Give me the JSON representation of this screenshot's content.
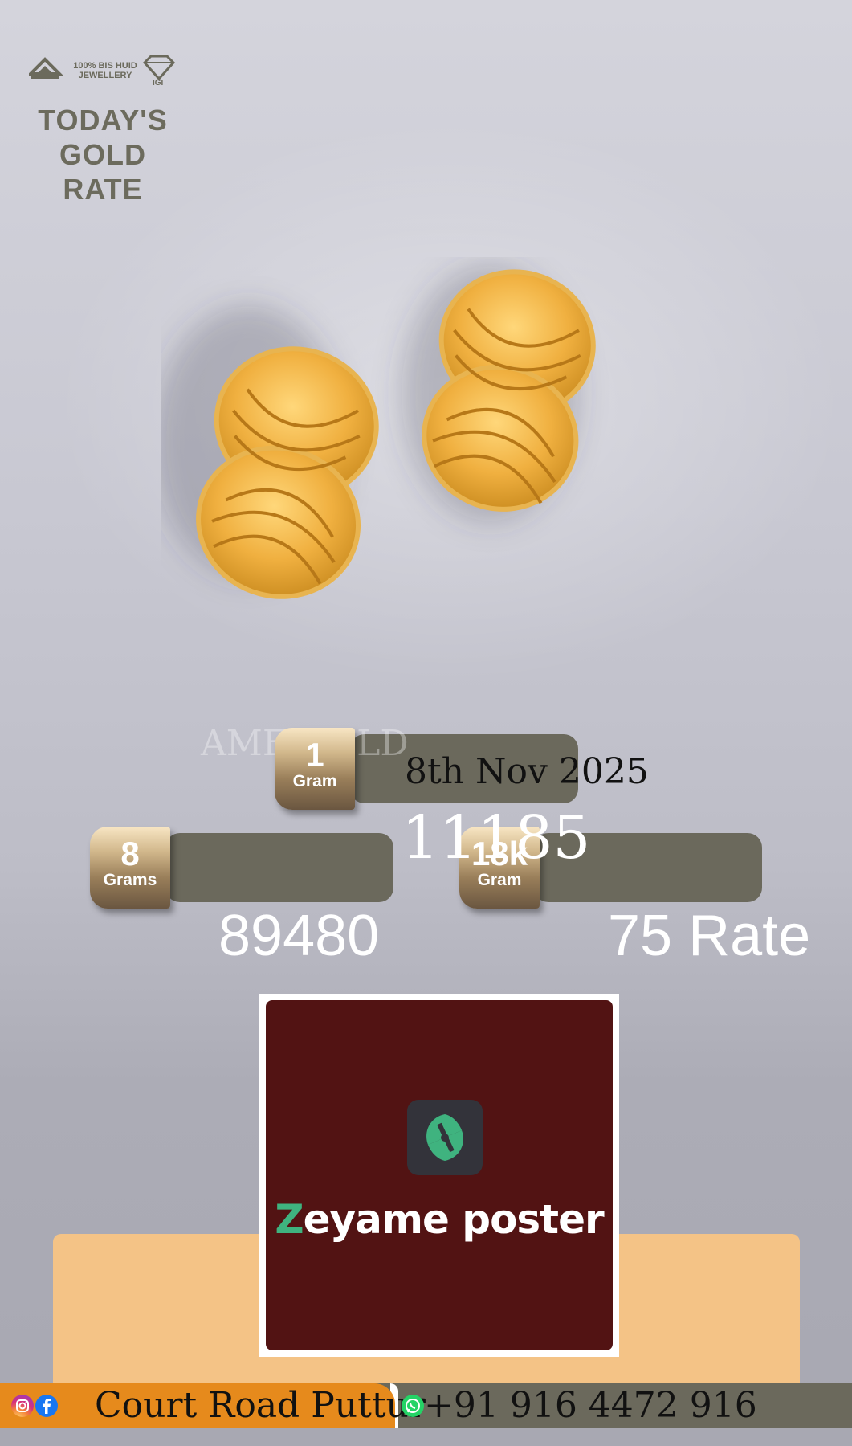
{
  "branding": {
    "bis_text": "100% BIS HUID JEWELLERY",
    "title_lines": [
      "TODAY'S",
      "GOLD",
      "RATE"
    ]
  },
  "shop_name_ghost": "AME GOLD",
  "date": "8th Nov 2025",
  "rates": {
    "one_gram": {
      "qty": "1",
      "unit": "Gram",
      "value": "11185"
    },
    "eight_grams": {
      "qty": "8",
      "unit": "Grams",
      "value": "89480"
    },
    "eighteen_k": {
      "qty": "18k",
      "unit": "Gram",
      "value": "75 Rate"
    }
  },
  "logo": {
    "brand_first": "Z",
    "brand_rest": "eyame poster"
  },
  "footer": {
    "address": "Court Road Puttur",
    "phone": "+91 916 4472 916"
  },
  "colors": {
    "pill": "#6b695c",
    "footer_orange": "#e68a1c",
    "peach": "#f4c386",
    "logo_bg": "#521313",
    "logo_green": "#3fb37f",
    "title": "#6c6b5d"
  },
  "icons": [
    "bis-hallmark-icon",
    "diamond-icon",
    "instagram-icon",
    "facebook-icon",
    "whatsapp-icon"
  ]
}
